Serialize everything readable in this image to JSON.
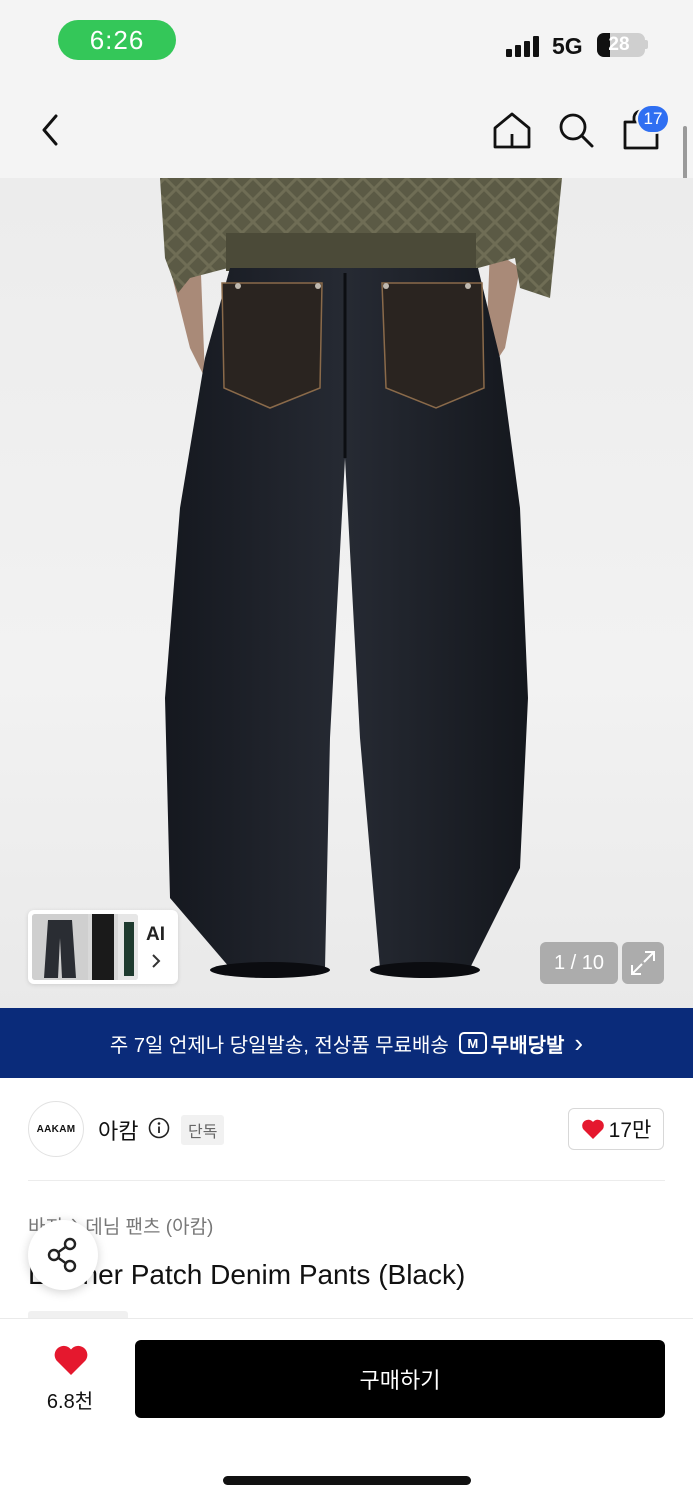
{
  "status_bar": {
    "time": "6:26",
    "network": "5G",
    "battery": "28",
    "battery_level": 0.28
  },
  "nav": {
    "cart_count": "17"
  },
  "gallery": {
    "ai_label": "AI",
    "counter": "1 / 10"
  },
  "banner": {
    "text": "주 7일 언제나 당일발송, 전상품 무료배송",
    "badge_letter": "M",
    "brand_text": "무배당발",
    "chevron": "›"
  },
  "brand": {
    "logo_text": "AAKAM",
    "name": "아캄",
    "exclusive_tag": "단독",
    "likes": "17만"
  },
  "product": {
    "breadcrumb": [
      "바지",
      "›",
      "데님 팬츠 (아캄)"
    ],
    "title": "Leather Patch Denim Pants (Black)"
  },
  "bottom_bar": {
    "wish_count": "6.8천",
    "buy_label": "구매하기"
  },
  "colors": {
    "accent_blue": "#2f6ff2",
    "banner_navy": "#0a2b7a",
    "heart_red": "#e5182e",
    "status_green": "#34c759"
  }
}
